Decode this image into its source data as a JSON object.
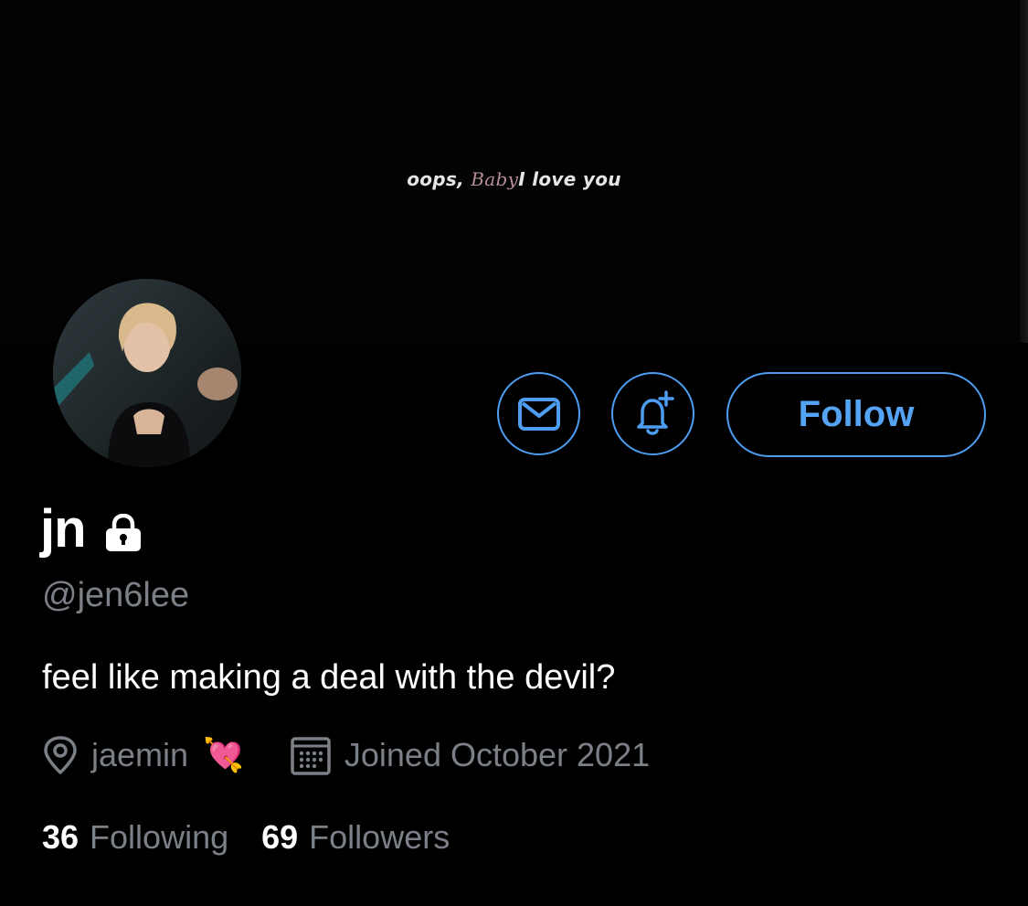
{
  "banner": {
    "caption_prefix": "oops, ",
    "caption_script": "Baby",
    "caption_suffix": "I love you"
  },
  "profile": {
    "display_name": "jn",
    "protected_icon": "lock-icon",
    "handle": "@jen6lee",
    "bio": "feel like making a deal with the devil?",
    "location": "jaemin",
    "location_emoji": "💘",
    "joined": "Joined October 2021"
  },
  "actions": {
    "message_icon": "mail-icon",
    "notify_icon": "bell-plus-icon",
    "follow_label": "Follow"
  },
  "stats": {
    "following_count": "36",
    "following_label": "Following",
    "followers_count": "69",
    "followers_label": "Followers"
  },
  "colors": {
    "accent": "#4d9ef2",
    "secondary_text": "#7b8087",
    "background": "#000000"
  }
}
